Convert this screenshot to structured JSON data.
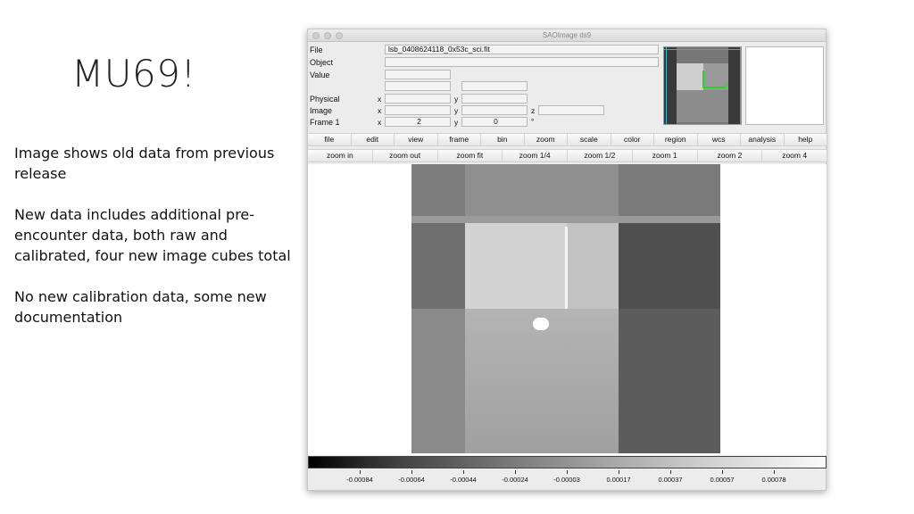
{
  "slide": {
    "title": "MU69!",
    "bullets": [
      "Image shows old data from previous release",
      "New data includes additional pre-encounter data, both raw and calibrated, four new image cubes total",
      "No new calibration data, some new documentation"
    ]
  },
  "ds9": {
    "window_title": "SAOImage ds9",
    "info": {
      "file_label": "File",
      "file_value": "lsb_0408624118_0x53c_sci.fit",
      "object_label": "Object",
      "object_value": "",
      "value_label": "Value",
      "value_value": "",
      "physical_label": "Physical",
      "image_label": "Image",
      "frame_label": "Frame 1",
      "x_label": "x",
      "y_label": "y",
      "z_label": "z",
      "frame_x": "2",
      "frame_y": "0",
      "frame_symbol": "°"
    },
    "menu_buttons": [
      "file",
      "edit",
      "view",
      "frame",
      "bin",
      "zoom",
      "scale",
      "color",
      "region",
      "wcs",
      "analysis",
      "help"
    ],
    "zoom_buttons": [
      "zoom in",
      "zoom out",
      "zoom fit",
      "zoom 1/4",
      "zoom 1/2",
      "zoom 1",
      "zoom 2",
      "zoom 4"
    ],
    "colorbar_ticks": [
      "-0.00084",
      "-0.00064",
      "-0.00044",
      "-0.00024",
      "-0.00003",
      "0.00017",
      "0.00037",
      "0.00057",
      "0.00078"
    ]
  }
}
